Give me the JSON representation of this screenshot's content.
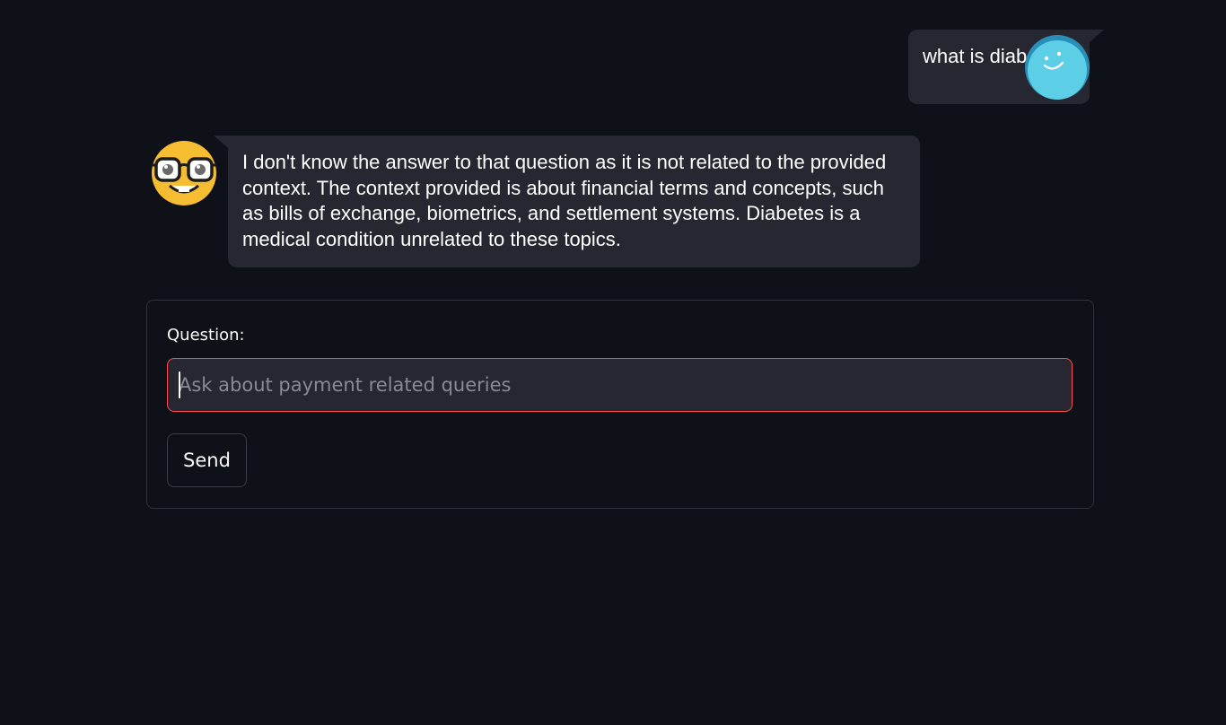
{
  "chat": {
    "messages": [
      {
        "role": "user",
        "avatar_icon": "smiley-blue-avatar-icon",
        "text": "what is diabetes?"
      },
      {
        "role": "assistant",
        "avatar_icon": "nerd-face-emoji-icon",
        "text": "I don't know the answer to that question as it is not related to the provided context. The context provided is about financial terms and concepts, such as bills of exchange, biometrics, and settlement systems. Diabetes is a medical condition unrelated to these topics."
      }
    ]
  },
  "form": {
    "label": "Question:",
    "input_value": "",
    "input_placeholder": "Ask about payment related queries",
    "send_label": "Send"
  },
  "colors": {
    "background": "#0e1117",
    "bubble": "#262730",
    "input_border_focus": "#ff4b4b",
    "user_avatar": "#5ccfe6",
    "bot_avatar": "#f7bd32"
  }
}
